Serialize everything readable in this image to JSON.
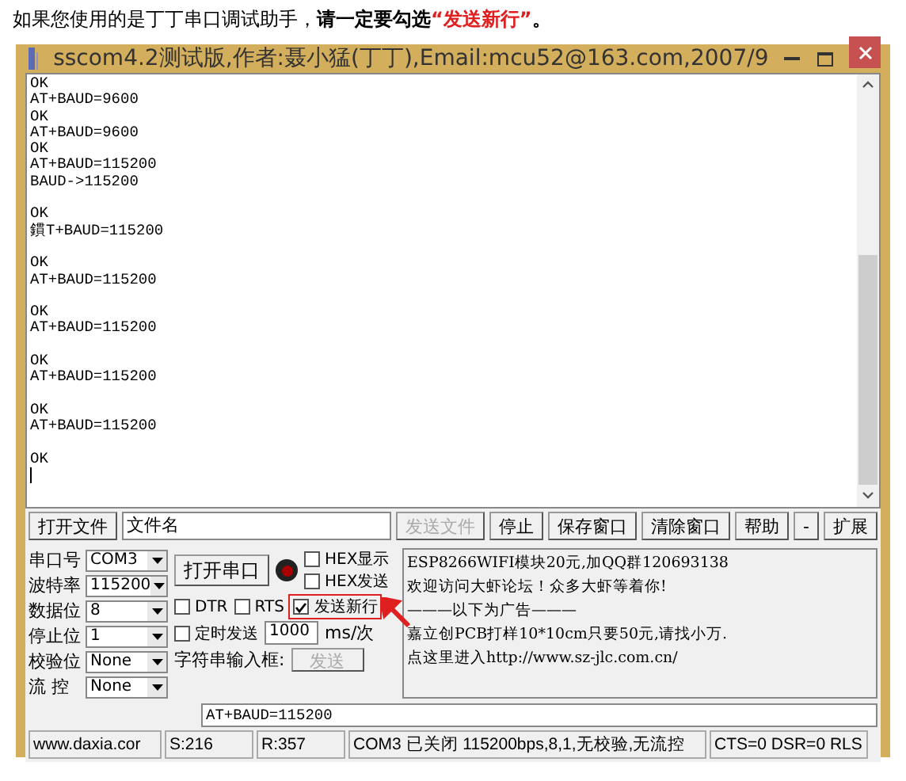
{
  "heading": [
    {
      "text": "如果您使用的是丁丁串口调试助手，",
      "kind": "plain"
    },
    {
      "text": "请一定要勾选",
      "kind": "bold"
    },
    {
      "text": "“发送新行”",
      "kind": "red"
    },
    {
      "text": "。",
      "kind": "bold"
    }
  ],
  "window": {
    "title": "sscom4.2测试版,作者:聂小猛(丁丁),Email:mcu52@163.com,2007/9"
  },
  "terminal": {
    "blocks": [
      [
        "OK",
        "AT+BAUD=9600",
        "OK",
        "AT+BAUD=9600",
        "OK",
        "AT+BAUD=115200",
        "BAUD->115200"
      ],
      [
        "OK",
        "鏆T+BAUD=115200"
      ],
      [
        "OK",
        "AT+BAUD=115200"
      ],
      [
        "OK",
        "AT+BAUD=115200"
      ],
      [
        "OK",
        "AT+BAUD=115200"
      ],
      [
        "OK",
        "AT+BAUD=115200"
      ],
      [
        "OK"
      ]
    ]
  },
  "toolbar": {
    "open_file": "打开文件",
    "file_name": "文件名",
    "buttons": [
      {
        "label": "发送文件",
        "disabled": true
      },
      {
        "label": "停止",
        "disabled": false
      },
      {
        "label": "保存窗口",
        "disabled": false
      },
      {
        "label": "清除窗口",
        "disabled": false
      },
      {
        "label": "帮助",
        "disabled": false
      },
      {
        "label": "-",
        "disabled": false
      },
      {
        "label": "扩展",
        "disabled": false
      }
    ]
  },
  "settings": [
    {
      "label": "串口号",
      "value": "COM3"
    },
    {
      "label": "波特率",
      "value": "115200"
    },
    {
      "label": "数据位",
      "value": "8"
    },
    {
      "label": "停止位",
      "value": "1"
    },
    {
      "label": "校验位",
      "value": "None"
    },
    {
      "label": "流 控",
      "value": "None"
    }
  ],
  "open_port": "打开串口",
  "port_open": false,
  "checks": {
    "hex_display": {
      "label": "HEX显示",
      "checked": false
    },
    "hex_send": {
      "label": "HEX发送",
      "checked": false
    },
    "dtr": {
      "label": "DTR",
      "checked": false
    },
    "rts": {
      "label": "RTS",
      "checked": false
    },
    "send_newline": {
      "label": "发送新行",
      "checked": true
    },
    "timed_send": {
      "label": "定时发送",
      "checked": false
    }
  },
  "interval": {
    "value": "1000",
    "unit": "ms/次"
  },
  "input_label": "字符串输入框:",
  "send": {
    "label": "发送",
    "disabled": true
  },
  "input": {
    "value": "AT+BAUD=115200"
  },
  "ads": [
    "ESP8266WIFI模块20元,加QQ群120693138",
    "欢迎访问大虾论坛！众多大虾等着你!",
    "———以下为广告———",
    "嘉立创PCB打样10*10cm只要50元,请找小万.",
    "点这里进入http://www.sz-jlc.com.cn/"
  ],
  "status_bar": [
    "www.daxia.cor",
    "S:216",
    "R:357",
    "COM3 已关闭  115200bps,8,1,无校验,无流控",
    "CTS=0 DSR=0 RLS"
  ]
}
